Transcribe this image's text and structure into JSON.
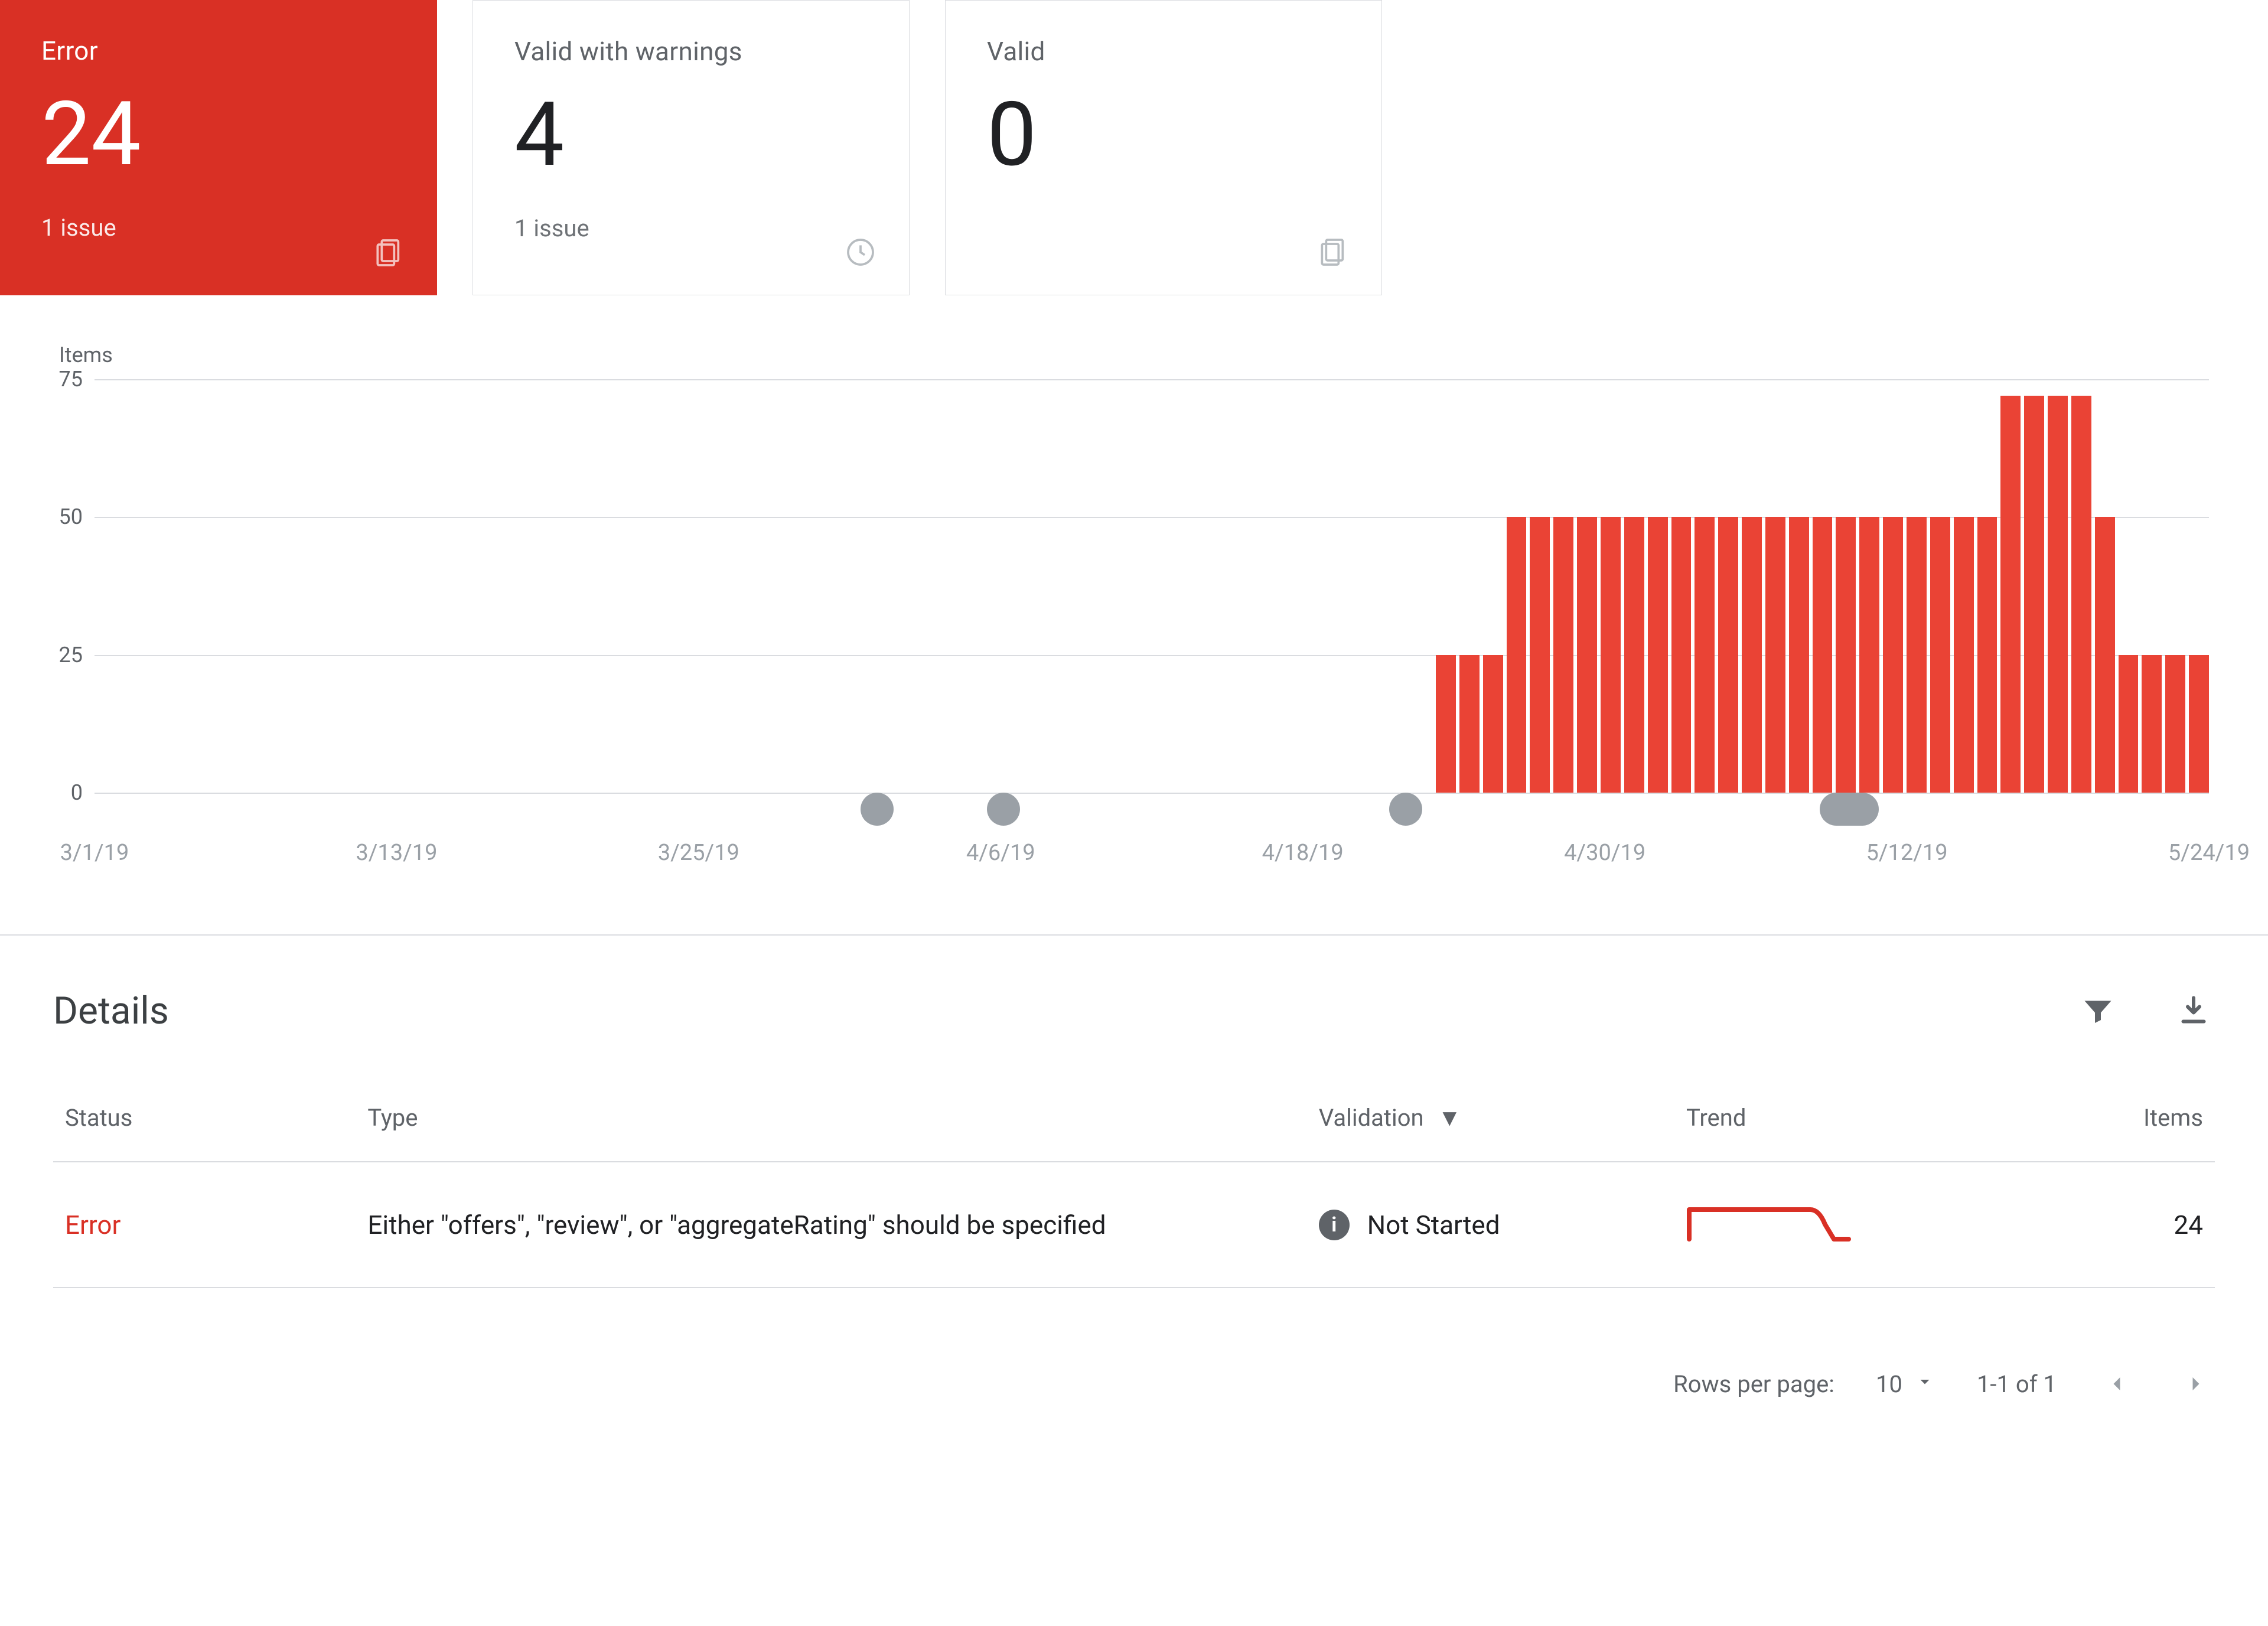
{
  "cards": [
    {
      "label": "Error",
      "value": "24",
      "sub": "1 issue",
      "active": true,
      "icon": "pages"
    },
    {
      "label": "Valid with warnings",
      "value": "4",
      "sub": "1 issue",
      "active": false,
      "icon": "clock"
    },
    {
      "label": "Valid",
      "value": "0",
      "sub": "",
      "active": false,
      "icon": "pages"
    }
  ],
  "chart_data": {
    "type": "bar",
    "ylabel": "Items",
    "y_ticks": [
      0,
      25,
      50,
      75
    ],
    "ylim": [
      0,
      75
    ],
    "x_ticks": [
      "3/1/19",
      "3/13/19",
      "3/25/19",
      "4/6/19",
      "4/18/19",
      "4/30/19",
      "5/12/19",
      "5/24/19"
    ],
    "categories": [
      "3/1/19",
      "3/2/19",
      "3/3/19",
      "3/4/19",
      "3/5/19",
      "3/6/19",
      "3/7/19",
      "3/8/19",
      "3/9/19",
      "3/10/19",
      "3/11/19",
      "3/12/19",
      "3/13/19",
      "3/14/19",
      "3/15/19",
      "3/16/19",
      "3/17/19",
      "3/18/19",
      "3/19/19",
      "3/20/19",
      "3/21/19",
      "3/22/19",
      "3/23/19",
      "3/24/19",
      "3/25/19",
      "3/26/19",
      "3/27/19",
      "3/28/19",
      "3/29/19",
      "3/30/19",
      "3/31/19",
      "4/1/19",
      "4/2/19",
      "4/3/19",
      "4/4/19",
      "4/5/19",
      "4/6/19",
      "4/7/19",
      "4/8/19",
      "4/9/19",
      "4/10/19",
      "4/11/19",
      "4/12/19",
      "4/13/19",
      "4/14/19",
      "4/15/19",
      "4/16/19",
      "4/17/19",
      "4/18/19",
      "4/19/19",
      "4/20/19",
      "4/21/19",
      "4/22/19",
      "4/23/19",
      "4/24/19",
      "4/25/19",
      "4/26/19",
      "4/27/19",
      "4/28/19",
      "4/29/19",
      "4/30/19",
      "5/1/19",
      "5/2/19",
      "5/3/19",
      "5/4/19",
      "5/5/19",
      "5/6/19",
      "5/7/19",
      "5/8/19",
      "5/9/19",
      "5/10/19",
      "5/11/19",
      "5/12/19",
      "5/13/19",
      "5/14/19",
      "5/15/19",
      "5/16/19",
      "5/17/19",
      "5/18/19",
      "5/19/19",
      "5/20/19",
      "5/21/19",
      "5/22/19",
      "5/23/19",
      "5/24/19",
      "5/25/19",
      "5/26/19",
      "5/27/19",
      "5/28/19",
      "5/29/19"
    ],
    "values": [
      0,
      0,
      0,
      0,
      0,
      0,
      0,
      0,
      0,
      0,
      0,
      0,
      0,
      0,
      0,
      0,
      0,
      0,
      0,
      0,
      0,
      0,
      0,
      0,
      0,
      0,
      0,
      0,
      0,
      0,
      0,
      0,
      0,
      0,
      0,
      0,
      0,
      0,
      0,
      0,
      0,
      0,
      0,
      0,
      0,
      0,
      0,
      0,
      0,
      0,
      0,
      0,
      0,
      0,
      0,
      0,
      0,
      25,
      25,
      25,
      50,
      50,
      50,
      50,
      50,
      50,
      50,
      50,
      50,
      50,
      50,
      50,
      50,
      50,
      50,
      50,
      50,
      50,
      50,
      50,
      50,
      72,
      72,
      72,
      72,
      50,
      25,
      25,
      25,
      25
    ],
    "markers": [
      {
        "pos_pct": 37,
        "double": false
      },
      {
        "pos_pct": 43,
        "double": false
      },
      {
        "pos_pct": 62,
        "double": false
      },
      {
        "pos_pct": 83,
        "double": true
      }
    ]
  },
  "details": {
    "title": "Details",
    "columns": {
      "status": "Status",
      "type": "Type",
      "validation": "Validation",
      "trend": "Trend",
      "items": "Items"
    },
    "rows": [
      {
        "status": "Error",
        "type": "Either \"offers\", \"review\", or \"aggregateRating\" should be specified",
        "validation": "Not Started",
        "items": "24"
      }
    ]
  },
  "pagination": {
    "rows_label": "Rows per page:",
    "rows_value": "10",
    "range": "1-1 of 1"
  }
}
